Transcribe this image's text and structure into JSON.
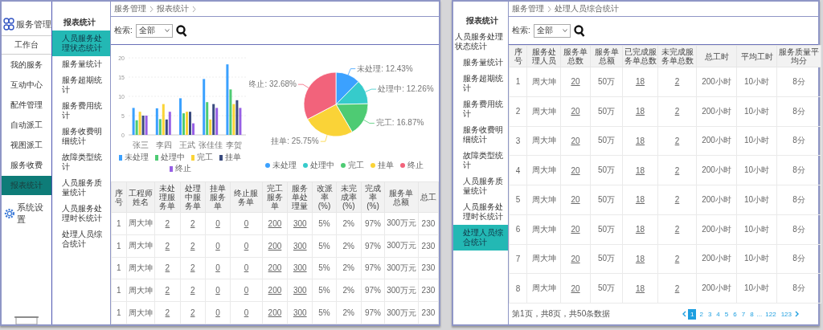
{
  "left_screen": {
    "nav": {
      "title": "服务管理",
      "workbench": "工作台",
      "items": [
        {
          "label": "我的服务",
          "selected": false
        },
        {
          "label": "互动中心",
          "selected": false
        },
        {
          "label": "配件管理",
          "selected": false
        },
        {
          "label": "自动派工",
          "selected": false
        },
        {
          "label": "视图派工",
          "selected": false
        },
        {
          "label": "服务收费",
          "selected": false
        },
        {
          "label": "报表统计",
          "selected": true
        }
      ],
      "settings": "系统设置"
    },
    "subnav": {
      "title": "报表统计",
      "items": [
        {
          "label": "人员服务处理状态统计",
          "selected": true
        },
        {
          "label": "服务量统计",
          "selected": false
        },
        {
          "label": "服务超期统计",
          "selected": false
        },
        {
          "label": "服务费用统计",
          "selected": false
        },
        {
          "label": "服务收费明细统计",
          "selected": false
        },
        {
          "label": "故障类型统计",
          "selected": false
        },
        {
          "label": "人员服务质量统计",
          "selected": false
        },
        {
          "label": "人员服务处理时长统计",
          "selected": false
        },
        {
          "label": "处理人员综合统计",
          "selected": false
        }
      ]
    },
    "breadcrumb": {
      "items": [
        "服务管理",
        "报表统计"
      ],
      "trailing_separator": true
    },
    "filter": {
      "label": "检索:",
      "value": "全部"
    },
    "bar_chart": {
      "chart_data": {
        "type": "bar",
        "grid": true,
        "categories": [
          "张三",
          "李四",
          "王武",
          "张佳佳",
          "李贺"
        ],
        "ylim": [
          0,
          20
        ],
        "yticks": [
          0,
          5,
          10,
          15,
          20
        ],
        "series": [
          {
            "name": "未处理",
            "color": "#3ba1ff",
            "values": [
              7,
              6.9,
              9.5,
              14.5,
              18.3
            ]
          },
          {
            "name": "处理中",
            "color": "#4ecb73",
            "values": [
              3.8,
              4.1,
              5.6,
              8.5,
              11.8
            ]
          },
          {
            "name": "完工",
            "color": "#fbd437",
            "values": [
              6,
              8,
              6,
              4,
              8
            ]
          },
          {
            "name": "挂单",
            "color": "#3a4b7f",
            "values": [
              5,
              4,
              6,
              8,
              9
            ]
          },
          {
            "name": "终止",
            "color": "#975fe5",
            "values": [
              5,
              6,
              3,
              7,
              7
            ]
          }
        ]
      }
    },
    "pie_chart": {
      "chart_data": {
        "type": "pie",
        "categories": [
          "未处理",
          "处理中",
          "完工",
          "挂单",
          "终止"
        ],
        "values": [
          12.43,
          12.26,
          16.87,
          25.75,
          32.68
        ],
        "colors": [
          "#3ba1ff",
          "#36cbcb",
          "#4ecb73",
          "#fad337",
          "#f2637b"
        ],
        "value_labels": [
          "未处理: 12.43%",
          "处理中: 12.26%",
          "完工: 16.87%",
          "挂单: 25.75%",
          "终止: 32.68%"
        ]
      }
    },
    "table": {
      "columns": [
        {
          "label": "序号",
          "link": false
        },
        {
          "label": "工程师姓名",
          "link": false
        },
        {
          "label": "未处理服务单",
          "link": true
        },
        {
          "label": "处理中服务单",
          "link": true
        },
        {
          "label": "挂单服务单",
          "link": true
        },
        {
          "label": "终止服务单",
          "link": true
        },
        {
          "label": "完工服务单",
          "link": true
        },
        {
          "label": "服务单处理量",
          "link": true
        },
        {
          "label": "改派率 (%)",
          "link": false
        },
        {
          "label": "未完成率 (%)",
          "link": false
        },
        {
          "label": "完成率 (%)",
          "link": false
        },
        {
          "label": "服务单总额",
          "link": false
        },
        {
          "label": "总工",
          "link": false
        }
      ],
      "rows": [
        [
          "1",
          "周大坤",
          "2",
          "2",
          "0",
          "0",
          "200",
          "300",
          "5%",
          "2%",
          "97%",
          "300万元",
          "230"
        ],
        [
          "1",
          "周大坤",
          "2",
          "2",
          "0",
          "0",
          "200",
          "300",
          "5%",
          "2%",
          "97%",
          "300万元",
          "230"
        ],
        [
          "1",
          "周大坤",
          "2",
          "2",
          "0",
          "0",
          "200",
          "300",
          "5%",
          "2%",
          "97%",
          "300万元",
          "230"
        ],
        [
          "1",
          "周大坤",
          "2",
          "2",
          "0",
          "0",
          "200",
          "300",
          "5%",
          "2%",
          "97%",
          "300万元",
          "230"
        ],
        [
          "1",
          "周大坤",
          "2",
          "2",
          "0",
          "0",
          "200",
          "300",
          "5%",
          "2%",
          "97%",
          "300万元",
          "230"
        ]
      ]
    }
  },
  "right_screen": {
    "subnav": {
      "title": "报表统计",
      "items": [
        {
          "label": "人员服务处理状态统计",
          "selected": false
        },
        {
          "label": "服务量统计",
          "selected": false
        },
        {
          "label": "服务超期统计",
          "selected": false
        },
        {
          "label": "服务费用统计",
          "selected": false
        },
        {
          "label": "服务收费明细统计",
          "selected": false
        },
        {
          "label": "故障类型统计",
          "selected": false
        },
        {
          "label": "人员服务质量统计",
          "selected": false
        },
        {
          "label": "人员服务处理时长统计",
          "selected": false
        },
        {
          "label": "处理人员综合统计",
          "selected": true
        }
      ]
    },
    "breadcrumb": {
      "items": [
        "服务管理",
        "处理人员综合统计"
      ]
    },
    "filter": {
      "label": "检索:",
      "value": "全部"
    },
    "table": {
      "columns": [
        {
          "label": "序号",
          "link": false
        },
        {
          "label": "服务处理人员",
          "link": false
        },
        {
          "label": "服务单总数",
          "link": true
        },
        {
          "label": "服务单总额",
          "link": false
        },
        {
          "label": "已完成服务单总数",
          "link": true
        },
        {
          "label": "未完成服务单总数",
          "link": true
        },
        {
          "label": "总工时",
          "link": false
        },
        {
          "label": "平均工时",
          "link": false
        },
        {
          "label": "服务质量平均分",
          "link": false
        }
      ],
      "rows": [
        [
          "1",
          "周大坤",
          "20",
          "50万",
          "18",
          "2",
          "200小时",
          "10小时",
          "8分"
        ],
        [
          "2",
          "周大坤",
          "20",
          "50万",
          "18",
          "2",
          "200小时",
          "10小时",
          "8分"
        ],
        [
          "3",
          "周大坤",
          "20",
          "50万",
          "18",
          "2",
          "200小时",
          "10小时",
          "8分"
        ],
        [
          "4",
          "周大坤",
          "20",
          "50万",
          "18",
          "2",
          "200小时",
          "10小时",
          "8分"
        ],
        [
          "5",
          "周大坤",
          "20",
          "50万",
          "18",
          "2",
          "200小时",
          "10小时",
          "8分"
        ],
        [
          "6",
          "周大坤",
          "20",
          "50万",
          "18",
          "2",
          "200小时",
          "10小时",
          "8分"
        ],
        [
          "7",
          "周大坤",
          "20",
          "50万",
          "18",
          "2",
          "200小时",
          "10小时",
          "8分"
        ],
        [
          "8",
          "周大坤",
          "20",
          "50万",
          "18",
          "2",
          "200小时",
          "10小时",
          "8分"
        ]
      ]
    },
    "pagination": {
      "summary": "第1页，共8页，共50条数据",
      "pages": [
        {
          "label": "1",
          "selected": true
        },
        {
          "label": "2",
          "selected": false
        },
        {
          "label": "3",
          "selected": false
        },
        {
          "label": "4",
          "selected": false
        },
        {
          "label": "5",
          "selected": false
        },
        {
          "label": "6",
          "selected": false
        },
        {
          "label": "7",
          "selected": false
        },
        {
          "label": "8",
          "selected": false
        }
      ],
      "ellipsis": "...",
      "end_pages": [
        {
          "label": "122",
          "selected": false
        },
        {
          "label": "123",
          "selected": false
        }
      ]
    }
  }
}
